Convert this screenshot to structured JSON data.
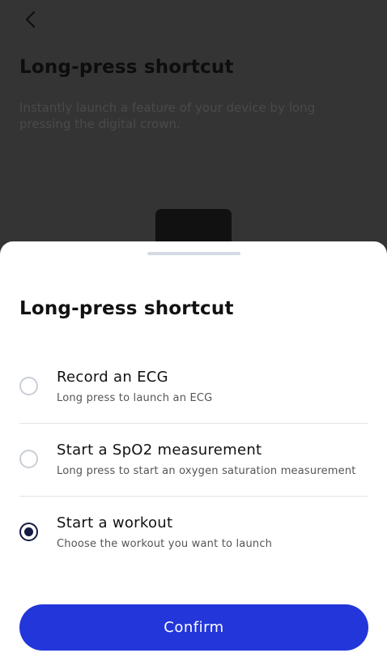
{
  "background_page": {
    "back_icon": "chevron-left-icon",
    "title": "Long-press shortcut",
    "description": "Instantly launch a feature of your device by long pressing the digital crown."
  },
  "sheet": {
    "title": "Long-press shortcut",
    "options": [
      {
        "title": "Record an ECG",
        "subtitle": "Long press to launch an ECG",
        "selected": false
      },
      {
        "title": "Start a SpO2 measurement",
        "subtitle": "Long press to start an oxygen saturation measurement",
        "selected": false
      },
      {
        "title": "Start a workout",
        "subtitle": "Choose the workout you want to launch",
        "selected": true
      }
    ],
    "confirm_label": "Confirm"
  },
  "colors": {
    "overlay_bg": "#343434",
    "accent": "#2336d9",
    "radio_selected": "#141a44"
  }
}
